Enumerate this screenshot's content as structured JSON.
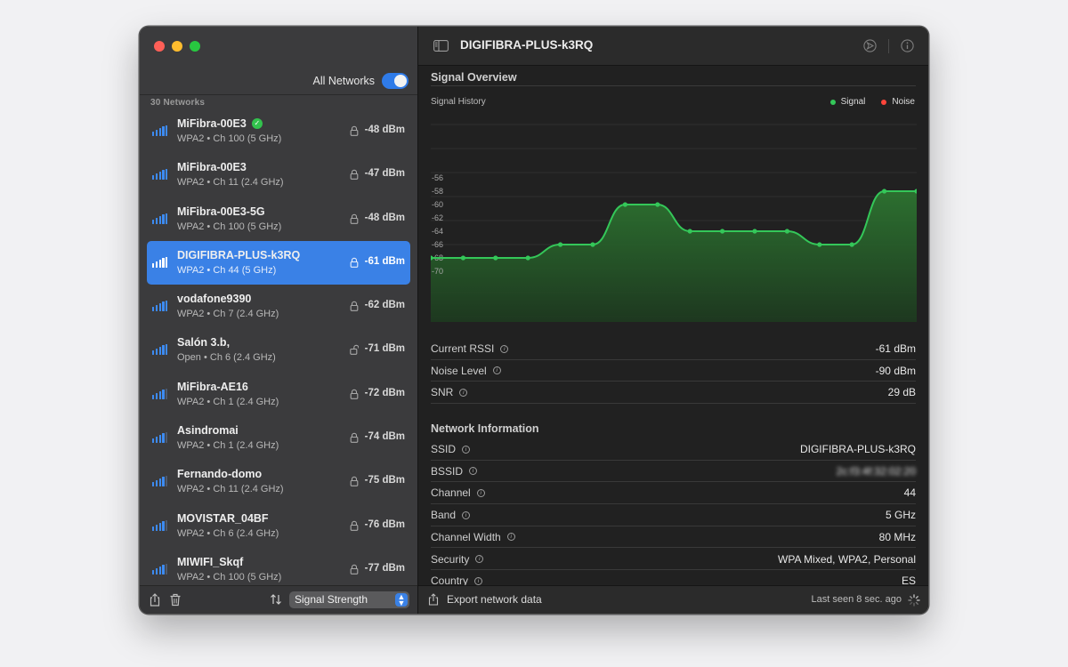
{
  "sidebar": {
    "all_networks_label": "All Networks",
    "all_networks_on": true,
    "count_label": "30 Networks",
    "networks": [
      {
        "name": "MiFibra-00E3",
        "sub": "WPA2 • Ch 100 (5 GHz)",
        "rssi": "-48 dBm",
        "connected": true,
        "locked": true
      },
      {
        "name": "MiFibra-00E3",
        "sub": "WPA2 • Ch 11 (2.4 GHz)",
        "rssi": "-47 dBm",
        "connected": false,
        "locked": true
      },
      {
        "name": "MiFibra-00E3-5G",
        "sub": "WPA2 • Ch 100 (5 GHz)",
        "rssi": "-48 dBm",
        "connected": false,
        "locked": true
      },
      {
        "name": "DIGIFIBRA-PLUS-k3RQ",
        "sub": "WPA2 • Ch 44 (5 GHz)",
        "rssi": "-61 dBm",
        "connected": false,
        "locked": true,
        "selected": true
      },
      {
        "name": "vodafone9390",
        "sub": "WPA2 • Ch 7 (2.4 GHz)",
        "rssi": "-62 dBm",
        "connected": false,
        "locked": true
      },
      {
        "name": "Salón 3.b,",
        "sub": "Open • Ch 6 (2.4 GHz)",
        "rssi": "-71 dBm",
        "connected": false,
        "locked": false
      },
      {
        "name": "MiFibra-AE16",
        "sub": "WPA2 • Ch 1 (2.4 GHz)",
        "rssi": "-72 dBm",
        "connected": false,
        "locked": true
      },
      {
        "name": "Asindromai",
        "sub": "WPA2 • Ch 1 (2.4 GHz)",
        "rssi": "-74 dBm",
        "connected": false,
        "locked": true
      },
      {
        "name": "Fernando-domo",
        "sub": "WPA2 • Ch 11 (2.4 GHz)",
        "rssi": "-75 dBm",
        "connected": false,
        "locked": true
      },
      {
        "name": "MOVISTAR_04BF",
        "sub": "WPA2 • Ch 6 (2.4 GHz)",
        "rssi": "-76 dBm",
        "connected": false,
        "locked": true
      },
      {
        "name": "MIWIFI_Skqf",
        "sub": "WPA2 • Ch 100 (5 GHz)",
        "rssi": "-77 dBm",
        "connected": false,
        "locked": true
      }
    ],
    "sort_label": "Signal Strength"
  },
  "main": {
    "title": "DIGIFIBRA-PLUS-k3RQ",
    "signal_overview_title": "Signal Overview",
    "chart_label": "Signal History",
    "legend": [
      {
        "label": "Signal",
        "color": "#34c759"
      },
      {
        "label": "Noise",
        "color": "#ff453a"
      }
    ],
    "signal_rows": [
      {
        "key": "Current RSSI",
        "value": "-61 dBm"
      },
      {
        "key": "Noise Level",
        "value": "-90 dBm"
      },
      {
        "key": "SNR",
        "value": "29 dB"
      }
    ],
    "network_info_title": "Network Information",
    "info_rows": [
      {
        "key": "SSID",
        "value": "DIGIFIBRA-PLUS-k3RQ"
      },
      {
        "key": "BSSID",
        "value": "2c:f3:4f:32:02:20",
        "blurred": true
      },
      {
        "key": "Channel",
        "value": "44"
      },
      {
        "key": "Band",
        "value": "5 GHz"
      },
      {
        "key": "Channel Width",
        "value": "80 MHz"
      },
      {
        "key": "Security",
        "value": "WPA Mixed, WPA2, Personal"
      },
      {
        "key": "Country",
        "value": "ES"
      }
    ],
    "export_label": "Export network data",
    "last_seen": "Last seen 8 sec. ago"
  },
  "chart_data": {
    "type": "line",
    "title": "Signal History",
    "ylabel": "",
    "ylim": [
      -72,
      -54
    ],
    "y_ticks": [
      -56,
      -58,
      -60,
      -62,
      -64,
      -66,
      -68,
      -70
    ],
    "series": [
      {
        "name": "Signal",
        "values": [
          -68,
          -68,
          -68,
          -68,
          -66,
          -66,
          -60,
          -60,
          -64,
          -64,
          -64,
          -64,
          -66,
          -66,
          -58,
          -58
        ]
      },
      {
        "name": "Noise",
        "values": []
      }
    ],
    "grid": true,
    "legend": "top-right",
    "colors": {
      "signal": "#34c759",
      "noise": "#ff453a"
    }
  }
}
